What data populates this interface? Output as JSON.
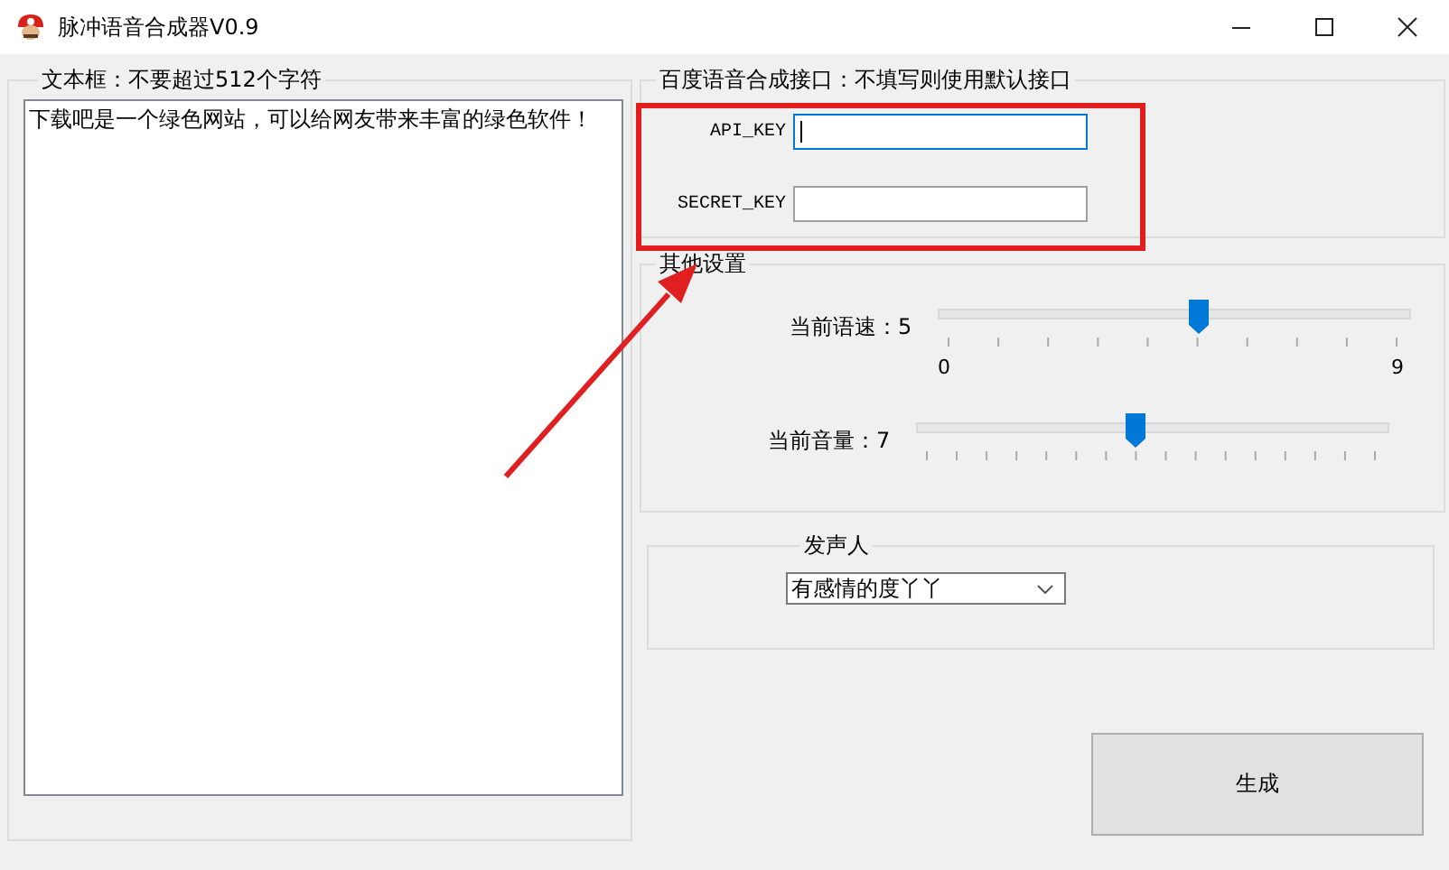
{
  "window": {
    "title": "脉冲语音合成器V0.9"
  },
  "text_box": {
    "label": "文本框：不要超过512个字符",
    "value": "下载吧是一个绿色网站，可以给网友带来丰富的绿色软件！"
  },
  "api_group": {
    "label": "百度语音合成接口：不填写则使用默认接口",
    "fields": [
      {
        "label": "API_KEY",
        "focused": true
      },
      {
        "label": "SECRET_KEY",
        "focused": false
      }
    ]
  },
  "other_settings": {
    "label": "其他设置",
    "sliders": [
      {
        "label": "当前语速：5",
        "level": 0.55,
        "min_label": "0",
        "max_label": "9"
      },
      {
        "label": "当前音量：7",
        "level": 0.46
      }
    ]
  },
  "speaker": {
    "label": "发声人",
    "value": "有感情的度丫丫"
  },
  "buttons": [
    "生成"
  ]
}
